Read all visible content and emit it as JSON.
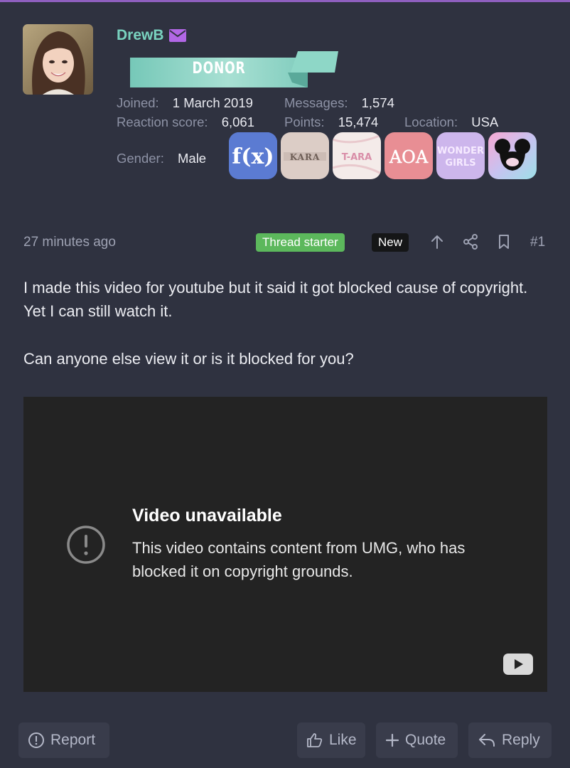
{
  "user": {
    "name": "DrewB",
    "banner": "DONOR",
    "joined_label": "Joined:",
    "joined_value": "1 March 2019",
    "messages_label": "Messages:",
    "messages_value": "1,574",
    "reaction_label": "Reaction score:",
    "reaction_value": "6,061",
    "points_label": "Points:",
    "points_value": "15,474",
    "location_label": "Location:",
    "location_value": "USA",
    "gender_label": "Gender:",
    "gender_value": "Male",
    "badges": [
      {
        "name": "f(x)",
        "color": "#5b78d0"
      },
      {
        "name": "KARA",
        "color": "#d9cfc9"
      },
      {
        "name": "T-ARA",
        "color": "#f2e4e6"
      },
      {
        "name": "AOA",
        "color": "#e98f95"
      },
      {
        "name": "WONDER GIRLS",
        "color": "#c9b6e8"
      },
      {
        "name": "mouse",
        "color": "#f5b8d8"
      }
    ]
  },
  "post": {
    "time": "27 minutes ago",
    "thread_starter": "Thread starter",
    "new_label": "New",
    "number": "#1",
    "paragraph_1": "I made this video for youtube but it said it got blocked cause of copyright. Yet I can still watch it.",
    "paragraph_2": "Can anyone else view it or is it blocked for you?"
  },
  "video": {
    "title": "Video unavailable",
    "message": "This video contains content from UMG, who has blocked it on copyright grounds."
  },
  "actions": {
    "report": "Report",
    "like": "Like",
    "quote": "Quote",
    "reply": "Reply"
  },
  "colors": {
    "background": "#2f3240",
    "username": "#79d2bf",
    "thread_starter": "#5cb85c",
    "banner": "#8fd6c8"
  },
  "icons": [
    "mail-icon",
    "upvote-icon",
    "share-icon",
    "bookmark-icon",
    "alert-circle-icon",
    "youtube-icon",
    "report-icon",
    "like-icon",
    "plus-icon",
    "reply-icon"
  ]
}
